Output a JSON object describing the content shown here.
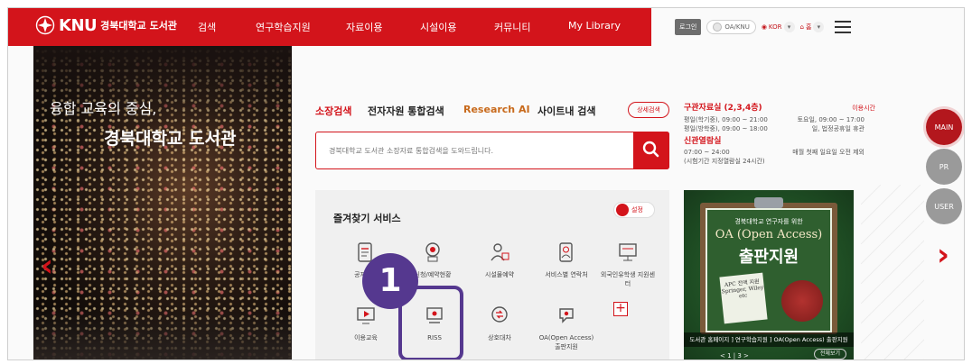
{
  "header": {
    "logo_text": "KNU",
    "logo_sub": "경북대학교 도서관",
    "nav": [
      "검색",
      "연구학습지원",
      "자료이용",
      "시설이용",
      "커뮤니티",
      "My Library"
    ],
    "login_label": "로그인",
    "toggle_label": "OA/KNU",
    "lang_label": "KOR",
    "home_label": "홈"
  },
  "hero": {
    "line1": "융합 교육의 중심,",
    "line2": "경북대학교 도서관"
  },
  "search": {
    "tabs": [
      "소장검색",
      "전자자원 통합검색",
      "Research AI",
      "사이트내 검색"
    ],
    "detail_label": "상세검색",
    "placeholder": "경북대학교 도서관 소장자료 통합검색을 도와드립니다."
  },
  "info": {
    "hours_title": "구관자료실 (2,3,4층)",
    "hours_link": "이용시간",
    "hours_rows": [
      [
        "평일(학기중), 09:00 ~ 21:00",
        "토요일, 09:00 ~ 17:00"
      ],
      [
        "평일(방학중), 09:00 ~ 18:00",
        "일, 법정공휴일 휴관"
      ]
    ],
    "reading_title": "신관열람실",
    "reading_rows": [
      [
        "07:00 ~ 24:00",
        "매월 첫째 일요일 오전 제외"
      ],
      [
        "(시험기간 지정열람실 24시간)",
        ""
      ]
    ]
  },
  "favorites": {
    "title": "즐겨찾기 서비스",
    "settings_label": "설정",
    "services": [
      "공지사항",
      "신청/예약현황",
      "시설물예약",
      "서비스별 연락처",
      "외국인유학생 지원센터",
      "이용교육",
      "RISS",
      "상호대차",
      "OA(Open Access) 출판지원"
    ]
  },
  "callout": {
    "number": "1"
  },
  "promo": {
    "line1": "경북대학교 연구자를 위한",
    "line2": "OA (Open Access)",
    "line3": "출판지원",
    "note": "APC 전액 지원 Springer, Wiley etc",
    "caption": "도서관 홈페이지 ] 연구학습지원 ] OA(Open Access) 출판지원",
    "pager": "< 1 | 3 >",
    "more_label": "전체보기"
  },
  "side": {
    "main": "MAIN",
    "pr": "PR",
    "user": "USER"
  },
  "colors": {
    "brand": "#d3141b",
    "callout": "#55388f",
    "side_active": "#b3171d",
    "side_idle": "#9a9a9a"
  }
}
